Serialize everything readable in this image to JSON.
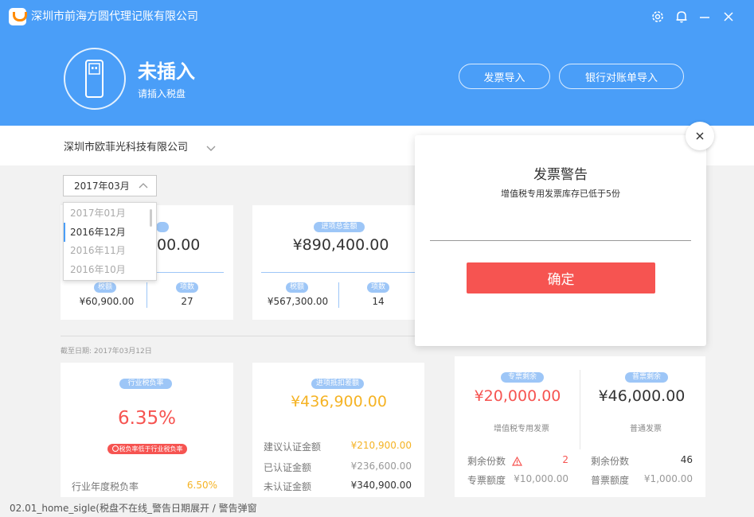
{
  "app": {
    "title": "深圳市前海方圆代理记账有限公司"
  },
  "window": {
    "icons": [
      "gear-icon",
      "bell-icon",
      "minimize-icon",
      "close-icon"
    ]
  },
  "disk": {
    "status": "未插入",
    "hint": "请插入税盘",
    "icon": "usb-drive-icon"
  },
  "actions": {
    "invoice_import": "发票导入",
    "bank_import": "银行对账单导入"
  },
  "company": {
    "name": "深圳市欧菲光科技有限公司"
  },
  "date_select": {
    "value": "2017年03月",
    "options": [
      "2017年01月",
      "2016年12月",
      "2016年11月",
      "2016年10月"
    ],
    "highlighted_index": 1
  },
  "card_output": {
    "amount_partial": "00.00",
    "tax_label": "税额",
    "tax_value": "¥60,900.00",
    "count_label": "项数",
    "count_value": "27"
  },
  "card_input": {
    "label": "进项总金额",
    "amount": "¥890,400.00",
    "tax_label": "税额",
    "tax_value": "¥567,300.00",
    "count_label": "项数",
    "count_value": "14"
  },
  "as_of": "截至日期: 2017年03月12日",
  "burden": {
    "label": "行业税负率",
    "value": "6.35%",
    "warning": "税负率低于行业税负率",
    "annual_label": "行业年度税负率",
    "annual_value": "6.50%"
  },
  "deduction": {
    "label": "进项抵扣差额",
    "amount": "¥436,900.00",
    "rows": [
      {
        "label": "建议认证金额",
        "value": "¥210,900.00"
      },
      {
        "label": "已认证金额",
        "value": "¥236,600.00"
      },
      {
        "label": "未认证金额",
        "value": "¥340,900.00"
      }
    ]
  },
  "remain": {
    "special": {
      "tag": "专票剩余",
      "amount": "¥20,000.00",
      "caption": "增值税专用发票",
      "count_label": "剩余份数",
      "count_value": "2",
      "quota_label": "专票额度",
      "quota_value": "¥10,000.00"
    },
    "normal": {
      "tag": "普票剩余",
      "amount": "¥46,000.00",
      "caption": "普通发票",
      "count_label": "剩余份数",
      "count_value": "46",
      "quota_label": "普票额度",
      "quota_value": "¥1,000.00"
    }
  },
  "modal": {
    "title": "发票警告",
    "message": "增值税专用发票库存已低于5份",
    "ok": "确定"
  },
  "footer": {
    "caption": "02.01_home_sigle(税盘不在线_警告日期展开 / 警告弹窗"
  },
  "colors": {
    "primary": "#4a9ef8",
    "danger": "#f65451",
    "gold": "#f5b324"
  }
}
